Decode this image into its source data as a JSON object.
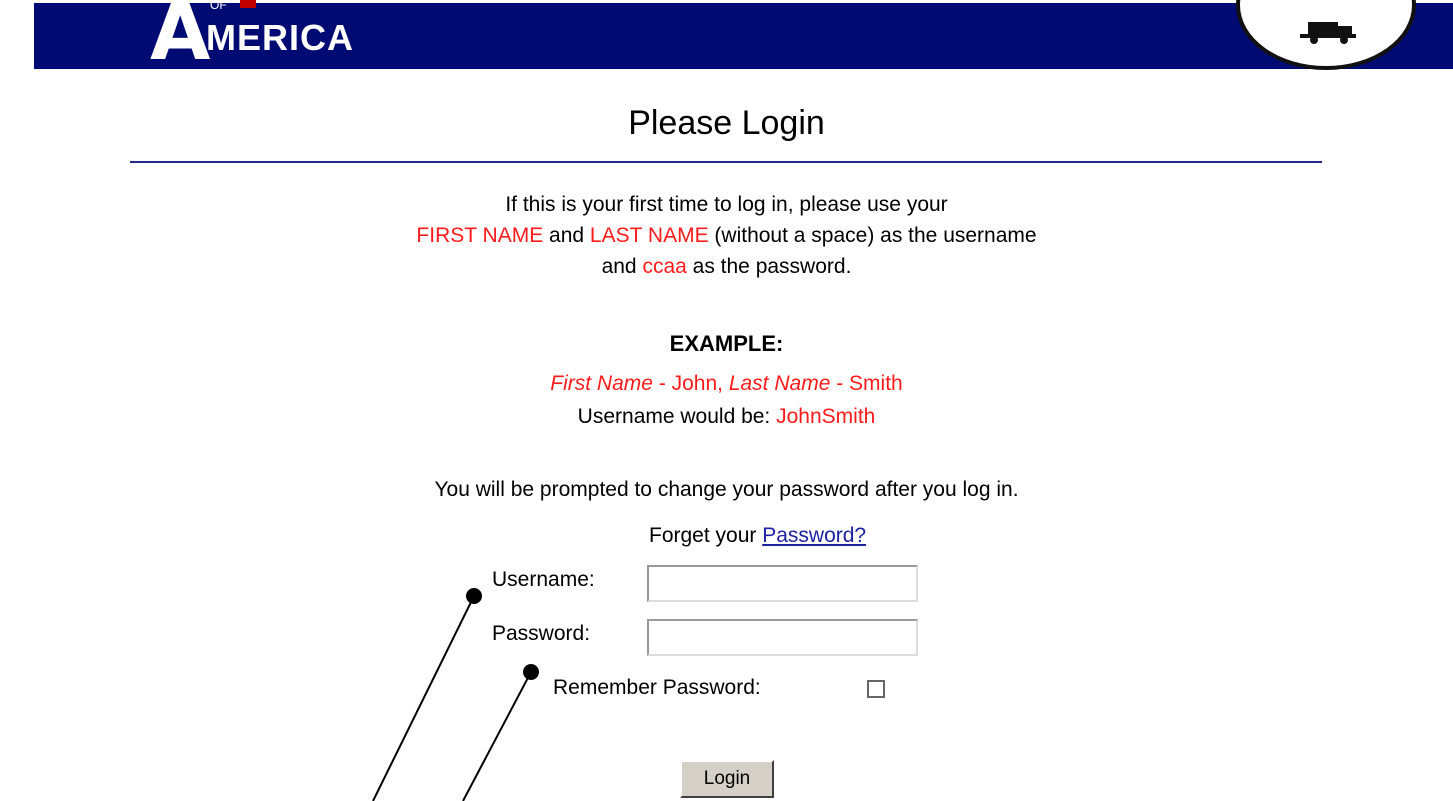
{
  "header": {
    "logo_of": "OF",
    "logo_letter": "A",
    "logo_rest": "MERICA"
  },
  "page": {
    "title": "Please Login"
  },
  "instructions": {
    "line1": "If this is your first time to log in, please use your",
    "first_name": "FIRST NAME",
    "and": " and ",
    "last_name": "LAST NAME",
    "line2_rest": " (without a space) as the username",
    "line3_pre": "and ",
    "password_hint": "ccaa",
    "line3_post": " as the password."
  },
  "example": {
    "heading": "EXAMPLE:",
    "first_label": "First Name",
    "first_value": " - John, ",
    "last_label": "Last Name",
    "last_value": " - Smith",
    "username_prefix": "Username would be: ",
    "username_value": "JohnSmith"
  },
  "notice": "You will be prompted to change your password after you log in.",
  "forgot": {
    "prefix": "Forget your ",
    "link": "Password?"
  },
  "form": {
    "username_label": "Username:",
    "password_label": "Password:",
    "remember_label": "Remember Password:",
    "username_value": "",
    "password_value": "",
    "remember_checked": false,
    "submit_label": "Login"
  }
}
